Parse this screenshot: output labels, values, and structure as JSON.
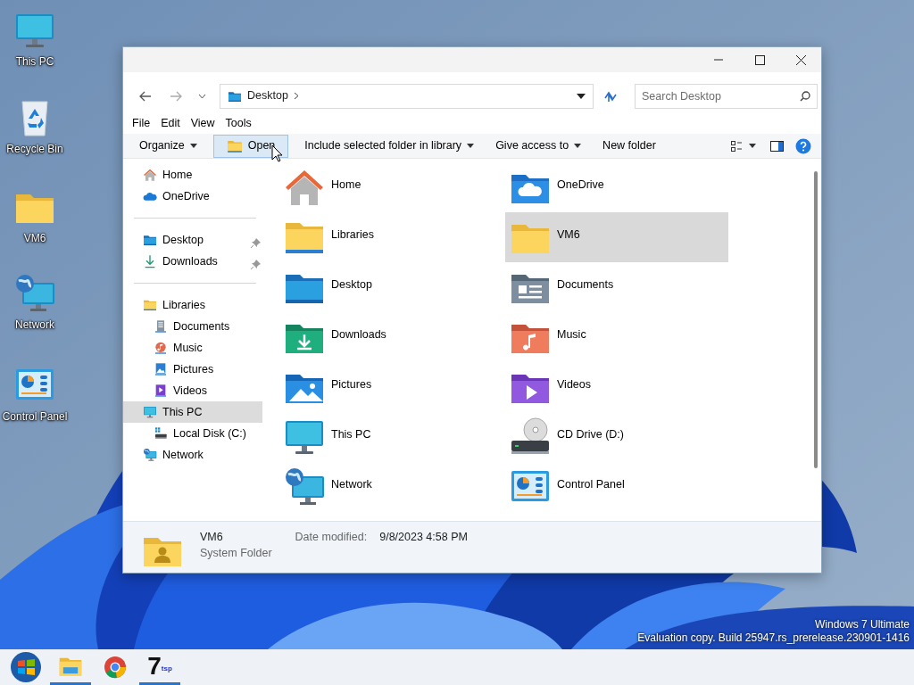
{
  "desktop_icons": [
    {
      "label": "This PC"
    },
    {
      "label": "Recycle Bin"
    },
    {
      "label": "VM6"
    },
    {
      "label": "Network"
    },
    {
      "label": "Control Panel"
    }
  ],
  "window": {
    "address": "Desktop",
    "search_placeholder": "Search Desktop",
    "menu": [
      "File",
      "Edit",
      "View",
      "Tools"
    ],
    "toolbar": [
      {
        "label": "Organize",
        "dropdown": true,
        "highlighted": false
      },
      {
        "label": "Open",
        "dropdown": false,
        "highlighted": true
      },
      {
        "label": "Include selected folder in library",
        "dropdown": true,
        "highlighted": false
      },
      {
        "label": "Give access to",
        "dropdown": true,
        "highlighted": false
      },
      {
        "label": "New folder",
        "dropdown": false,
        "highlighted": false
      }
    ],
    "navigation": [
      {
        "items": [
          {
            "label": "Home",
            "selected": false,
            "pinned": false
          },
          {
            "label": "OneDrive",
            "selected": false,
            "pinned": false
          }
        ]
      },
      {
        "items": [
          {
            "label": "Desktop",
            "selected": false,
            "pinned": true
          },
          {
            "label": "Downloads",
            "selected": false,
            "pinned": true
          }
        ]
      },
      {
        "items": [
          {
            "label": "Libraries",
            "selected": false,
            "pinned": false,
            "children": [
              {
                "label": "Documents",
                "selected": false,
                "pinned": false
              },
              {
                "label": "Music",
                "selected": false,
                "pinned": false
              },
              {
                "label": "Pictures",
                "selected": false,
                "pinned": false
              },
              {
                "label": "Videos",
                "selected": false,
                "pinned": false
              }
            ]
          },
          {
            "label": "This PC",
            "selected": true,
            "pinned": false,
            "children": [
              {
                "label": "Local Disk (C:)",
                "selected": false,
                "pinned": false
              }
            ]
          },
          {
            "label": "Network",
            "selected": false,
            "pinned": false
          }
        ]
      }
    ],
    "items": [
      {
        "label": "Home",
        "selected": false
      },
      {
        "label": "OneDrive",
        "selected": false
      },
      {
        "label": "Libraries",
        "selected": false
      },
      {
        "label": "VM6",
        "selected": true
      },
      {
        "label": "Desktop",
        "selected": false
      },
      {
        "label": "Documents",
        "selected": false
      },
      {
        "label": "Downloads",
        "selected": false
      },
      {
        "label": "Music",
        "selected": false
      },
      {
        "label": "Pictures",
        "selected": false
      },
      {
        "label": "Videos",
        "selected": false
      },
      {
        "label": "This PC",
        "selected": false
      },
      {
        "label": "CD Drive (D:)",
        "selected": false
      },
      {
        "label": "Network",
        "selected": false
      },
      {
        "label": "Control Panel",
        "selected": false
      }
    ],
    "details": {
      "name": "VM6",
      "type": "System Folder",
      "date_label": "Date modified:",
      "date_value": "9/8/2023 4:58 PM"
    }
  },
  "os_notice": [
    "Windows 7 Ultimate",
    "Evaluation copy. Build 25947.rs_prerelease.230901-1416"
  ],
  "taskbar": [
    {
      "kind": "start",
      "active": false
    },
    {
      "kind": "explorer",
      "active": true
    },
    {
      "kind": "chrome",
      "active": false
    },
    {
      "kind": "logo",
      "text": "7",
      "sub": "tsp",
      "active": true
    }
  ]
}
